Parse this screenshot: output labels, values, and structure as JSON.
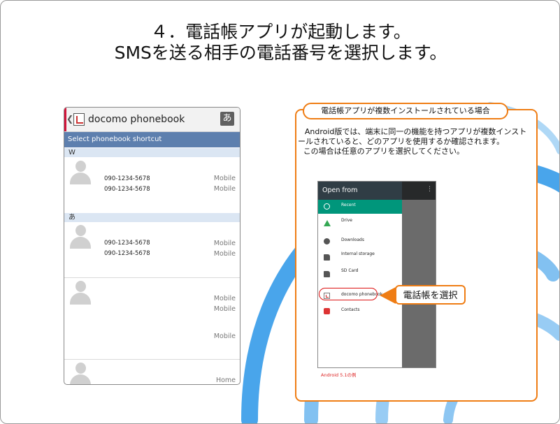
{
  "slide": {
    "title_line1": "４．電話帳アプリが起動します。",
    "title_line2": "SMSを送る相手の電話番号を選択します。"
  },
  "phonebook": {
    "back_glyph": "❮",
    "app_title": "docomo phonebook",
    "kana_button": "あ",
    "subheader": "Select phonebook shortcut",
    "sections": [
      {
        "header": "W"
      },
      {
        "header": "あ"
      }
    ],
    "contacts": [
      {
        "phone1": "090-1234-5678",
        "label1": "Mobile",
        "phone2": "090-1234-5678",
        "label2": "Mobile"
      },
      {
        "phone1": "090-1234-5678",
        "label1": "Mobile",
        "phone2": "090-1234-5678",
        "label2": "Mobile"
      },
      {
        "label1": "Mobile",
        "label2": "Mobile",
        "label3": "Mobile"
      },
      {
        "label1": "Home"
      }
    ]
  },
  "callout": {
    "tab_title": "電話帳アプリが複数インストールされている場合",
    "para1": "Android版では、端末に同一の機能を持つアプリが複数インストールされていると、どのアプリを使用するか確認されます。",
    "para2": "この場合は任意のアプリを選択してください。",
    "open_from": {
      "title": "Open from",
      "menu_glyph": "⋮",
      "items": [
        "Recent",
        "Drive",
        "Downloads",
        "Internal storage",
        "SD Card",
        "docomo phonebook",
        "Contacts"
      ],
      "highlighted": "docomo phonebook"
    },
    "arrow_label": "電話帳を選択",
    "version_note": "Android 5.1の例"
  },
  "colors": {
    "accent_orange": "#ef7d14",
    "header_blue": "#5d7fae",
    "section_blue": "#dbe6f3",
    "recent_teal": "#00967b",
    "deco_blue": "#1b8ee6"
  },
  "icons": [
    "back-chevron-icon",
    "phonebook-app-icon",
    "contact-avatar-icon",
    "clock-icon",
    "drive-icon",
    "download-icon",
    "storage-icon",
    "sd-card-icon",
    "contacts-icon",
    "more-vert-icon",
    "pointer-arrow-icon"
  ]
}
